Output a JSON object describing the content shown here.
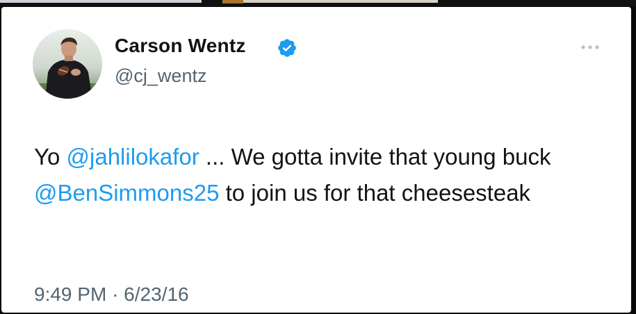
{
  "tweet": {
    "author_name": "Carson Wentz",
    "handle": "@cj_wentz",
    "verified": true,
    "text_part1": "Yo ",
    "mention1": "@jahlilokafor",
    "text_part2": " ... We gotta invite that young buck ",
    "mention2": "@BenSimmons25",
    "text_part3": " to join us for that cheesesteak",
    "time": "9:49 PM",
    "separator": "·",
    "date": "6/23/16"
  },
  "icons": {
    "verified": "verified-badge-icon",
    "more": "more-options-icon",
    "avatar": "profile-photo"
  },
  "colors": {
    "link": "#1d9bf0",
    "verified": "#1d9bf0",
    "text": "#0f1419",
    "secondary": "#536471",
    "card_bg": "#ffffff",
    "frame_bg": "#0a0a0a"
  }
}
